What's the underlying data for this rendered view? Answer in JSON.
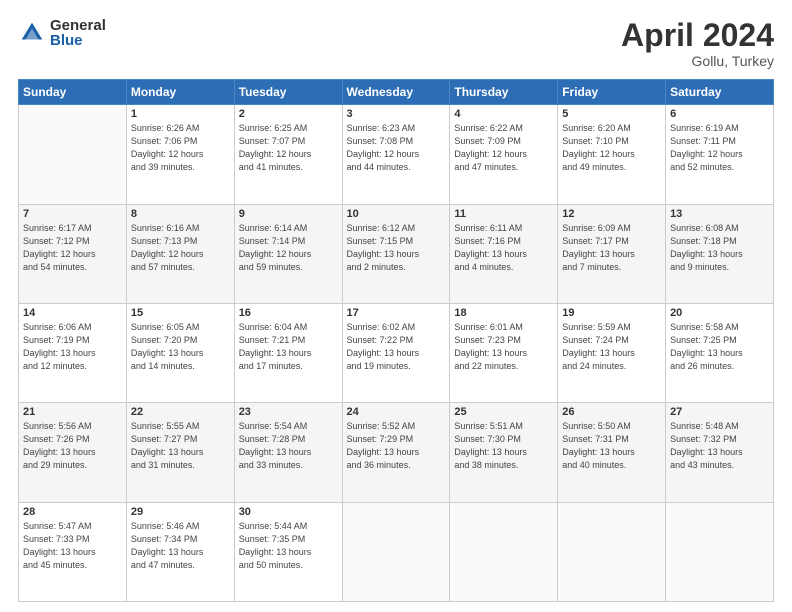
{
  "logo": {
    "general": "General",
    "blue": "Blue"
  },
  "header": {
    "month": "April 2024",
    "location": "Gollu, Turkey"
  },
  "weekdays": [
    "Sunday",
    "Monday",
    "Tuesday",
    "Wednesday",
    "Thursday",
    "Friday",
    "Saturday"
  ],
  "weeks": [
    [
      {
        "day": "",
        "info": ""
      },
      {
        "day": "1",
        "info": "Sunrise: 6:26 AM\nSunset: 7:06 PM\nDaylight: 12 hours\nand 39 minutes."
      },
      {
        "day": "2",
        "info": "Sunrise: 6:25 AM\nSunset: 7:07 PM\nDaylight: 12 hours\nand 41 minutes."
      },
      {
        "day": "3",
        "info": "Sunrise: 6:23 AM\nSunset: 7:08 PM\nDaylight: 12 hours\nand 44 minutes."
      },
      {
        "day": "4",
        "info": "Sunrise: 6:22 AM\nSunset: 7:09 PM\nDaylight: 12 hours\nand 47 minutes."
      },
      {
        "day": "5",
        "info": "Sunrise: 6:20 AM\nSunset: 7:10 PM\nDaylight: 12 hours\nand 49 minutes."
      },
      {
        "day": "6",
        "info": "Sunrise: 6:19 AM\nSunset: 7:11 PM\nDaylight: 12 hours\nand 52 minutes."
      }
    ],
    [
      {
        "day": "7",
        "info": "Sunrise: 6:17 AM\nSunset: 7:12 PM\nDaylight: 12 hours\nand 54 minutes."
      },
      {
        "day": "8",
        "info": "Sunrise: 6:16 AM\nSunset: 7:13 PM\nDaylight: 12 hours\nand 57 minutes."
      },
      {
        "day": "9",
        "info": "Sunrise: 6:14 AM\nSunset: 7:14 PM\nDaylight: 12 hours\nand 59 minutes."
      },
      {
        "day": "10",
        "info": "Sunrise: 6:12 AM\nSunset: 7:15 PM\nDaylight: 13 hours\nand 2 minutes."
      },
      {
        "day": "11",
        "info": "Sunrise: 6:11 AM\nSunset: 7:16 PM\nDaylight: 13 hours\nand 4 minutes."
      },
      {
        "day": "12",
        "info": "Sunrise: 6:09 AM\nSunset: 7:17 PM\nDaylight: 13 hours\nand 7 minutes."
      },
      {
        "day": "13",
        "info": "Sunrise: 6:08 AM\nSunset: 7:18 PM\nDaylight: 13 hours\nand 9 minutes."
      }
    ],
    [
      {
        "day": "14",
        "info": "Sunrise: 6:06 AM\nSunset: 7:19 PM\nDaylight: 13 hours\nand 12 minutes."
      },
      {
        "day": "15",
        "info": "Sunrise: 6:05 AM\nSunset: 7:20 PM\nDaylight: 13 hours\nand 14 minutes."
      },
      {
        "day": "16",
        "info": "Sunrise: 6:04 AM\nSunset: 7:21 PM\nDaylight: 13 hours\nand 17 minutes."
      },
      {
        "day": "17",
        "info": "Sunrise: 6:02 AM\nSunset: 7:22 PM\nDaylight: 13 hours\nand 19 minutes."
      },
      {
        "day": "18",
        "info": "Sunrise: 6:01 AM\nSunset: 7:23 PM\nDaylight: 13 hours\nand 22 minutes."
      },
      {
        "day": "19",
        "info": "Sunrise: 5:59 AM\nSunset: 7:24 PM\nDaylight: 13 hours\nand 24 minutes."
      },
      {
        "day": "20",
        "info": "Sunrise: 5:58 AM\nSunset: 7:25 PM\nDaylight: 13 hours\nand 26 minutes."
      }
    ],
    [
      {
        "day": "21",
        "info": "Sunrise: 5:56 AM\nSunset: 7:26 PM\nDaylight: 13 hours\nand 29 minutes."
      },
      {
        "day": "22",
        "info": "Sunrise: 5:55 AM\nSunset: 7:27 PM\nDaylight: 13 hours\nand 31 minutes."
      },
      {
        "day": "23",
        "info": "Sunrise: 5:54 AM\nSunset: 7:28 PM\nDaylight: 13 hours\nand 33 minutes."
      },
      {
        "day": "24",
        "info": "Sunrise: 5:52 AM\nSunset: 7:29 PM\nDaylight: 13 hours\nand 36 minutes."
      },
      {
        "day": "25",
        "info": "Sunrise: 5:51 AM\nSunset: 7:30 PM\nDaylight: 13 hours\nand 38 minutes."
      },
      {
        "day": "26",
        "info": "Sunrise: 5:50 AM\nSunset: 7:31 PM\nDaylight: 13 hours\nand 40 minutes."
      },
      {
        "day": "27",
        "info": "Sunrise: 5:48 AM\nSunset: 7:32 PM\nDaylight: 13 hours\nand 43 minutes."
      }
    ],
    [
      {
        "day": "28",
        "info": "Sunrise: 5:47 AM\nSunset: 7:33 PM\nDaylight: 13 hours\nand 45 minutes."
      },
      {
        "day": "29",
        "info": "Sunrise: 5:46 AM\nSunset: 7:34 PM\nDaylight: 13 hours\nand 47 minutes."
      },
      {
        "day": "30",
        "info": "Sunrise: 5:44 AM\nSunset: 7:35 PM\nDaylight: 13 hours\nand 50 minutes."
      },
      {
        "day": "",
        "info": ""
      },
      {
        "day": "",
        "info": ""
      },
      {
        "day": "",
        "info": ""
      },
      {
        "day": "",
        "info": ""
      }
    ]
  ]
}
